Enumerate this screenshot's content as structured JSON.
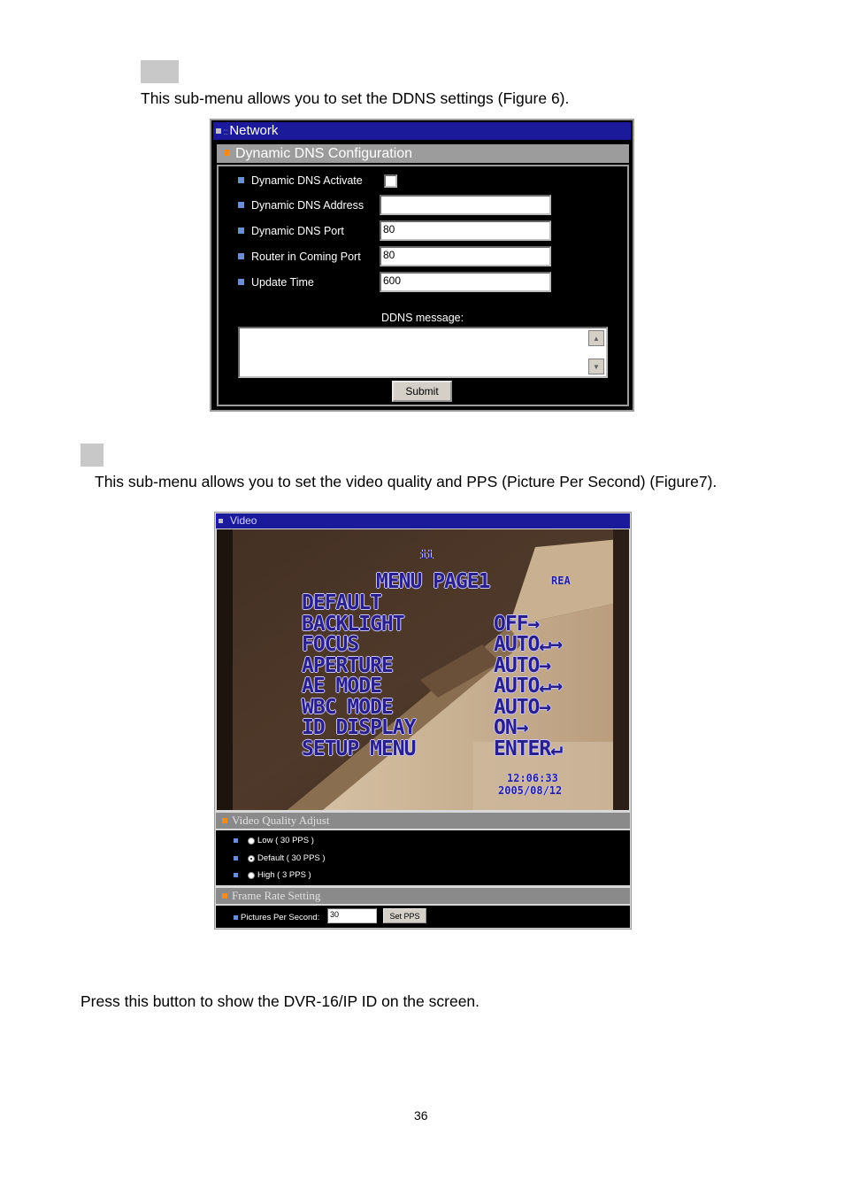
{
  "section1": {
    "description": "This sub-menu allows you to set the DDNS settings (Figure 6)."
  },
  "figure6": {
    "window_title": "Network",
    "section_title": "Dynamic DNS Configuration",
    "fields": [
      {
        "label": "Dynamic DNS Activate",
        "type": "checkbox",
        "checked": false
      },
      {
        "label": "Dynamic DNS Address",
        "type": "text",
        "value": ""
      },
      {
        "label": "Dynamic DNS Port",
        "type": "text",
        "value": "80"
      },
      {
        "label": "Router in Coming Port",
        "type": "text",
        "value": "80"
      },
      {
        "label": "Update Time",
        "type": "text",
        "value": "600"
      }
    ],
    "message_label": "DDNS message:",
    "submit_label": "Submit",
    "colors": {
      "title_bar": "#1a1a9a",
      "section_bar": "#9c9c9c",
      "bullet": "#6a8fd8",
      "section_marker": "#ff8a1a"
    },
    "icons": {
      "window_marker": "square-icon",
      "scroll_up": "scroll-up-arrow-icon",
      "scroll_down": "scroll-down-arrow-icon"
    }
  },
  "section2": {
    "description": "This sub-menu allows you to set the video quality and PPS (Picture Per Second) (Figure7)."
  },
  "figure7": {
    "window_title": "Video",
    "camera_osd": {
      "page_title": "MENU PAGE1",
      "top_right": "REA",
      "items": [
        {
          "name": "DEFAULT",
          "value": ""
        },
        {
          "name": "BACKLIGHT",
          "value": "OFF→"
        },
        {
          "name": "FOCUS",
          "value": "AUTO↵→"
        },
        {
          "name": "APERTURE",
          "value": "AUTO→"
        },
        {
          "name": "AE MODE",
          "value": "AUTO↵→"
        },
        {
          "name": "WBC MODE",
          "value": "AUTO→"
        },
        {
          "name": "ID DISPLAY",
          "value": "ON→"
        },
        {
          "name": "SETUP MENU",
          "value": "ENTER↵"
        }
      ],
      "timestamp_line1": "12:06:33",
      "timestamp_line2": "2005/08/12"
    },
    "quality_section_title": "Video Quality Adjust",
    "quality_options": [
      {
        "label": "Low ( 30 PPS )",
        "selected": false
      },
      {
        "label": "Default ( 30 PPS )",
        "selected": true
      },
      {
        "label": "High ( 3 PPS )",
        "selected": false
      }
    ],
    "frame_section_title": "Frame Rate Setting",
    "pps_label": "Pictures Per Second:",
    "pps_value": "30",
    "set_pps_label": "Set PPS",
    "colors": {
      "title_bar": "#1a1a9a",
      "section_bar": "#8a8a8a",
      "osd_text": "#2a1e8a"
    }
  },
  "section3": {
    "description": "Press this button to show the DVR-16/IP ID on the screen."
  },
  "page_number": "36"
}
